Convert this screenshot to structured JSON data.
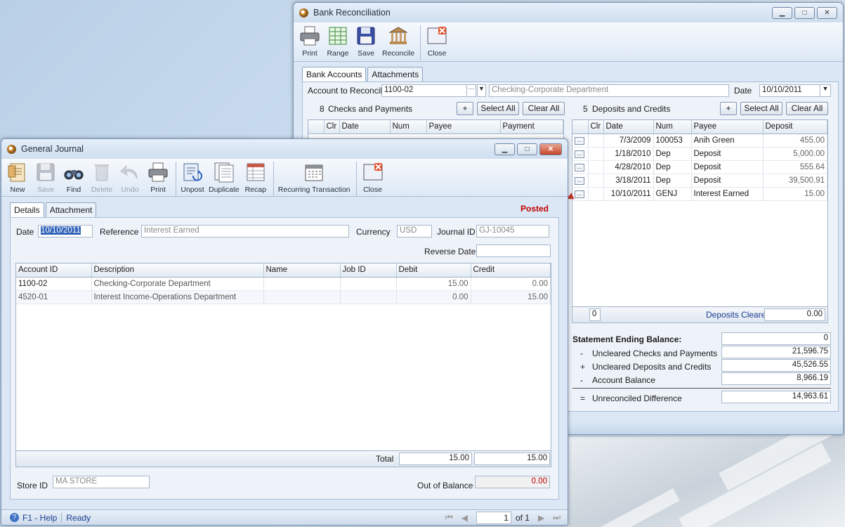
{
  "bank": {
    "title": "Bank Reconciliation",
    "toolbar": [
      "Print",
      "Range",
      "Save",
      "Reconcile",
      "Close"
    ],
    "tabs": [
      "Bank Accounts",
      "Attachments"
    ],
    "account_label": "Account to Reconcile",
    "account_value": "1100-02",
    "account_desc": "Checking-Corporate Department",
    "date_label": "Date",
    "date_value": "10/10/2011",
    "checks_count": "8",
    "checks_label": "Checks and Payments",
    "deposits_count": "5",
    "deposits_label": "Deposits and Credits",
    "plus": "+",
    "select_all": "Select All",
    "clear_all": "Clear All",
    "checks_headers": [
      "Clr",
      "Date",
      "Num",
      "Payee",
      "Payment"
    ],
    "deposit_headers": [
      "Clr",
      "Date",
      "Num",
      "Payee",
      "Deposit"
    ],
    "deposits": [
      {
        "btn": "...",
        "date": "7/3/2009",
        "num": "100053",
        "payee": "Anih Green",
        "amount": "455.00"
      },
      {
        "btn": "...",
        "date": "1/18/2010",
        "num": "Dep",
        "payee": "Deposit",
        "amount": "5,000.00"
      },
      {
        "btn": "...",
        "date": "4/28/2010",
        "num": "Dep",
        "payee": "Deposit",
        "amount": "555.64"
      },
      {
        "btn": "...",
        "date": "3/18/2011",
        "num": "Dep",
        "payee": "Deposit",
        "amount": "39,500.91"
      },
      {
        "btn": "...",
        "date": "10/10/2011",
        "num": "GENJ",
        "payee": "Interest Earned",
        "amount": "15.00"
      }
    ],
    "deposits_footer_count": "0",
    "deposits_cleared_label": "Deposits Cleared",
    "deposits_cleared_value": "0.00",
    "summary": {
      "ending_label": "Statement Ending Balance:",
      "ending_value": "0",
      "rows": [
        {
          "sign": "-",
          "label": "Uncleared Checks and Payments",
          "value": "21,596.75"
        },
        {
          "sign": "+",
          "label": "Uncleared Deposits and Credits",
          "value": "45,526.55"
        },
        {
          "sign": "-",
          "label": "Account Balance",
          "value": "8,966.19"
        }
      ],
      "diff_sign": "=",
      "diff_label": "Unreconciled Difference",
      "diff_value": "14,963.61"
    }
  },
  "journal": {
    "title": "General Journal",
    "toolbar": [
      {
        "label": "New",
        "enabled": true
      },
      {
        "label": "Save",
        "enabled": false
      },
      {
        "label": "Find",
        "enabled": true
      },
      {
        "label": "Delete",
        "enabled": false
      },
      {
        "label": "Undo",
        "enabled": false
      },
      {
        "label": "Print",
        "enabled": true
      },
      {
        "label": "Unpost",
        "enabled": true
      },
      {
        "label": "Duplicate",
        "enabled": true
      },
      {
        "label": "Recap",
        "enabled": true
      },
      {
        "label": "Recurring Transaction",
        "enabled": true
      },
      {
        "label": "Close",
        "enabled": true
      }
    ],
    "tabs": [
      "Details",
      "Attachment"
    ],
    "status": "Posted",
    "date_label": "Date",
    "date_value": "10/10/2011",
    "reference_label": "Reference",
    "reference_value": "Interest Earned",
    "currency_label": "Currency",
    "currency_value": "USD",
    "journal_id_label": "Journal ID",
    "journal_id_value": "GJ-10045",
    "reverse_date_label": "Reverse Date",
    "reverse_date_value": "",
    "headers": [
      "Account ID",
      "Description",
      "Name",
      "Job ID",
      "Debit",
      "Credit"
    ],
    "rows": [
      {
        "account": "1100-02",
        "desc": "Checking-Corporate Department",
        "name": "",
        "job": "",
        "debit": "15.00",
        "credit": "0.00"
      },
      {
        "account": "4520-01",
        "desc": "Interest Income-Operations Department",
        "name": "",
        "job": "",
        "debit": "0.00",
        "credit": "15.00"
      }
    ],
    "total_label": "Total",
    "total_debit": "15.00",
    "total_credit": "15.00",
    "store_label": "Store ID",
    "store_value": "MA STORE",
    "oob_label": "Out of Balance",
    "oob_value": "0.00",
    "status_help": "F1 - Help",
    "status_ready": "Ready",
    "page_value": "1",
    "page_of": "of 1"
  },
  "colors": {
    "posted": "#c00000",
    "link_text": "#1b3d8f",
    "oob": "#c00000"
  }
}
